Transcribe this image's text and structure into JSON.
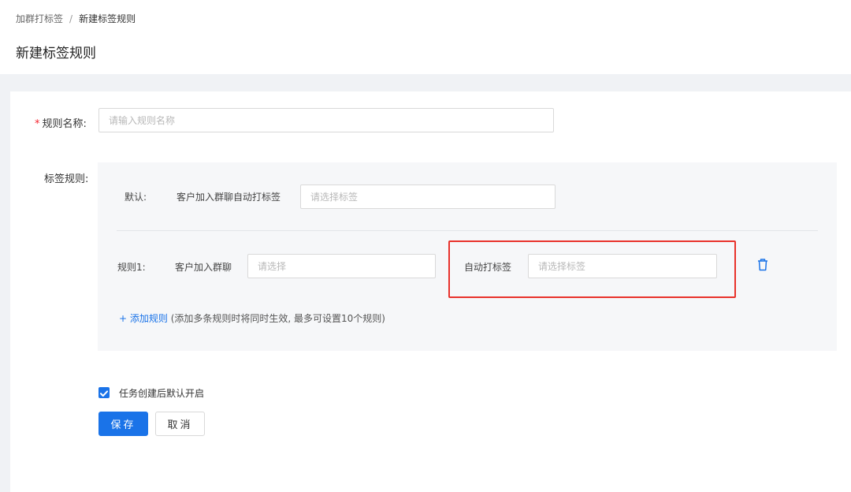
{
  "breadcrumb": {
    "parent": "加群打标签",
    "separator": "/",
    "current": "新建标签规则"
  },
  "page": {
    "title": "新建标签规则"
  },
  "form": {
    "rule_name": {
      "required_mark": "*",
      "label": "规则名称:",
      "placeholder": "请输入规则名称",
      "value": ""
    },
    "tag_rules": {
      "label": "标签规则:",
      "default": {
        "label": "默认:",
        "description": "客户加入群聊自动打标签",
        "placeholder": "请选择标签"
      },
      "rules": [
        {
          "label": "规则1:",
          "group_label": "客户加入群聊",
          "group_placeholder": "请选择",
          "tag_label": "自动打标签",
          "tag_placeholder": "请选择标签",
          "delete_icon": "trash-icon"
        }
      ],
      "add_rule": {
        "link_text": "+ 添加规则",
        "hint": "(添加多条规则时将同时生效, 最多可设置10个规则)"
      }
    },
    "auto_enable": {
      "checked": true,
      "label": "任务创建后默认开启"
    }
  },
  "actions": {
    "save": "保存",
    "cancel": "取消"
  },
  "colors": {
    "primary": "#1a73e8",
    "required": "#f5222d",
    "highlight_border": "#e8322b",
    "panel_bg": "#f6f7f9",
    "page_bg": "#f0f2f5"
  }
}
